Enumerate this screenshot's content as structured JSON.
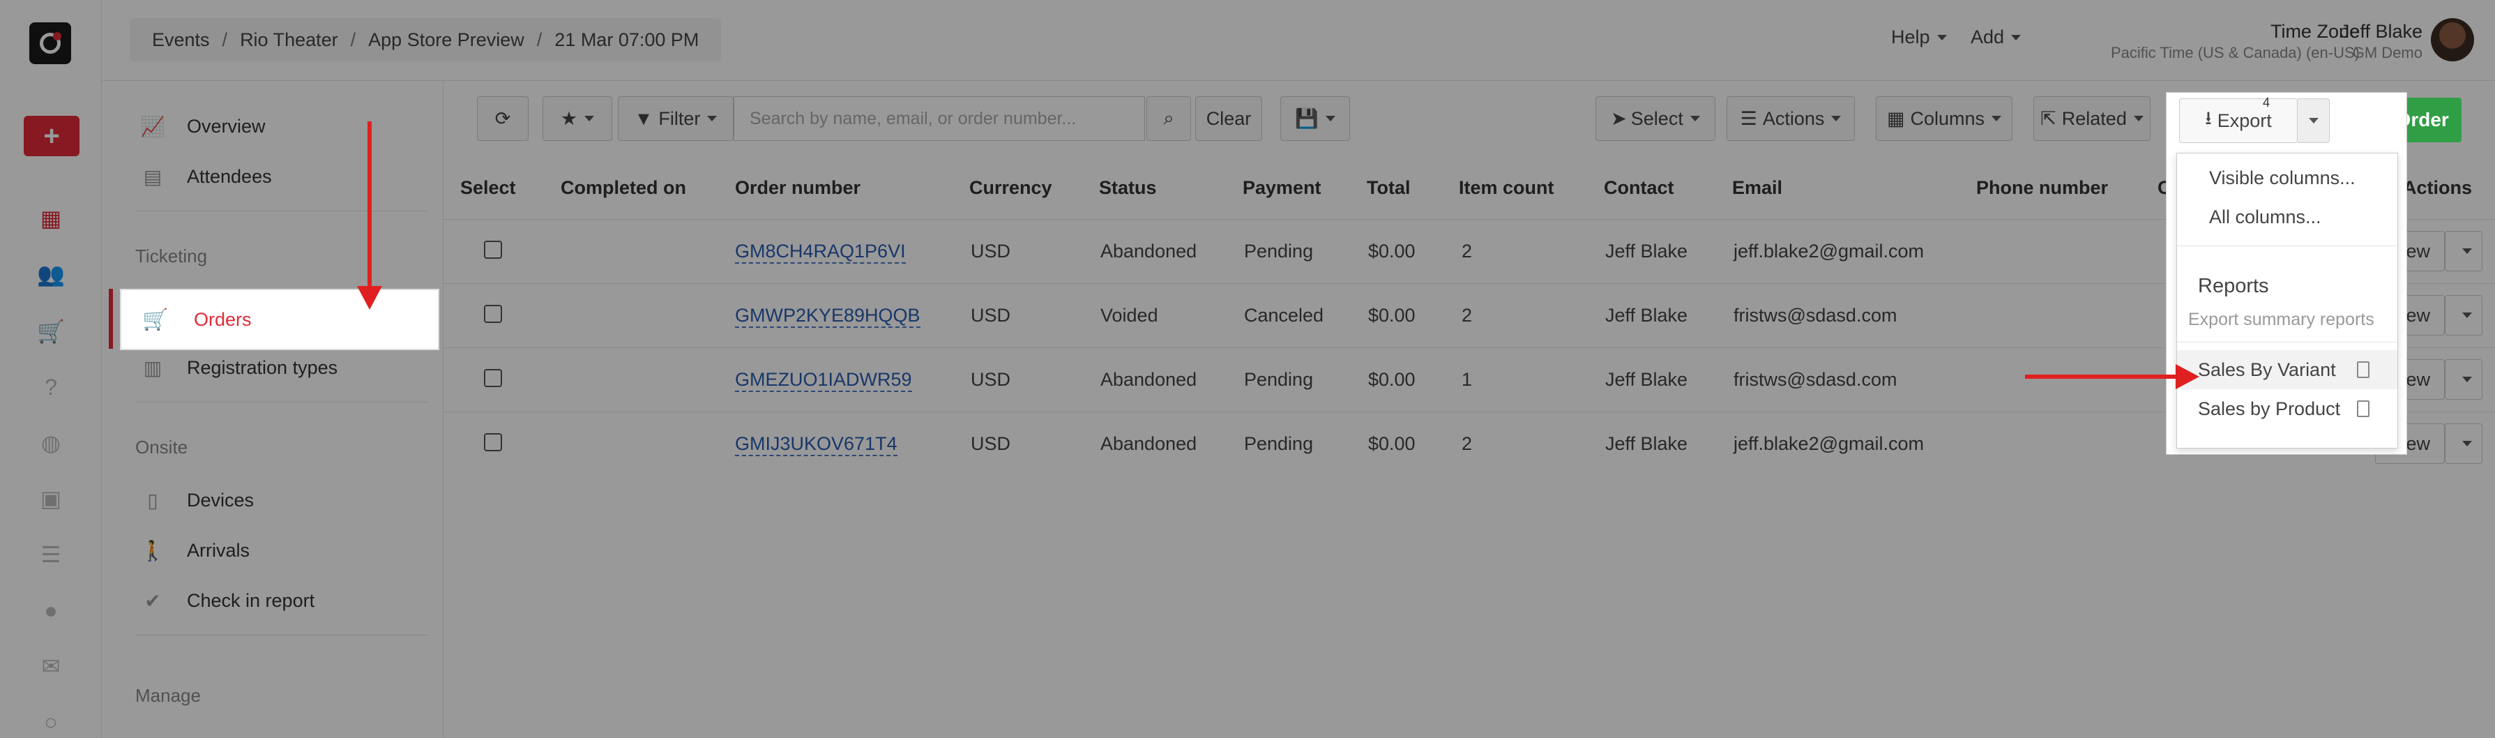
{
  "breadcrumb": [
    "Events",
    "Rio Theater",
    "App Store Preview",
    "21 Mar 07:00 PM"
  ],
  "topbar": {
    "help": "Help",
    "add": "Add",
    "timezone_label": "Time Zone",
    "timezone_value": "Pacific Time (US & Canada) (en-US)",
    "user_name": "Jeff Blake",
    "user_org": "GM Demo"
  },
  "sidenav": {
    "overview": "Overview",
    "attendees": "Attendees",
    "ticketing_head": "Ticketing",
    "orders": "Orders",
    "registration_types": "Registration types",
    "onsite_head": "Onsite",
    "devices": "Devices",
    "arrivals": "Arrivals",
    "check_in_report": "Check in report",
    "manage_head": "Manage"
  },
  "toolbar": {
    "filter": "Filter",
    "search_placeholder": "Search by name, email, or order number...",
    "clear": "Clear",
    "select": "Select",
    "actions": "Actions",
    "columns": "Columns",
    "related": "Related",
    "export": "Export",
    "export_count": "4",
    "new_order": "New Order"
  },
  "table": {
    "headers": [
      "Select",
      "Completed on",
      "Order number",
      "Currency",
      "Status",
      "Payment",
      "Total",
      "Item count",
      "Contact",
      "Email",
      "Phone number",
      "Or",
      "Actions"
    ],
    "rows": [
      {
        "order": "GM8CH4RAQ1P6VI",
        "currency": "USD",
        "status": "Abandoned",
        "payment": "Pending",
        "total": "$0.00",
        "items": "2",
        "contact": "Jeff Blake",
        "email": "jeff.blake2@gmail.com",
        "view": "View"
      },
      {
        "order": "GMWP2KYE89HQQB",
        "currency": "USD",
        "status": "Voided",
        "payment": "Canceled",
        "total": "$0.00",
        "items": "2",
        "contact": "Jeff Blake",
        "email": "fristws@sdasd.com",
        "view": "View"
      },
      {
        "order": "GMEZUO1IADWR59",
        "currency": "USD",
        "status": "Abandoned",
        "payment": "Pending",
        "total": "$0.00",
        "items": "1",
        "contact": "Jeff Blake",
        "email": "fristws@sdasd.com",
        "view": "View"
      },
      {
        "order": "GMIJ3UKOV671T4",
        "currency": "USD",
        "status": "Abandoned",
        "payment": "Pending",
        "total": "$0.00",
        "items": "2",
        "contact": "Jeff Blake",
        "email": "jeff.blake2@gmail.com",
        "view": "View"
      }
    ]
  },
  "export_menu": {
    "visible_columns": "Visible columns...",
    "all_columns": "All columns...",
    "reports_head": "Reports",
    "reports_sub": "Export summary reports",
    "sales_by_variant": "Sales By Variant",
    "sales_by_product": "Sales by Product"
  },
  "colors": {
    "brand_red": "#e12b3b",
    "success_green": "#2f9e44",
    "annotation_red": "#e02020"
  }
}
